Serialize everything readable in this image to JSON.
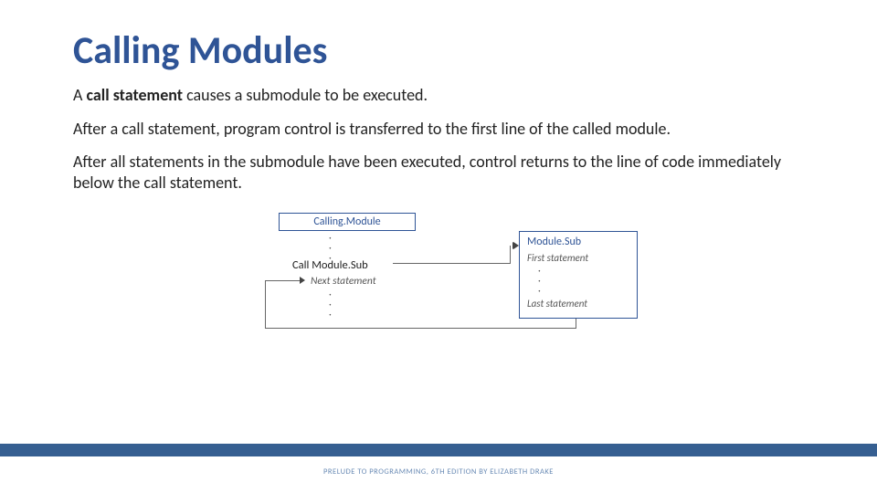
{
  "title": "Calling Modules",
  "para1_pre": "A ",
  "para1_bold": "call statement",
  "para1_post": " causes a submodule to be executed.",
  "para2": "After a call statement, program control is transferred to the first line of the called module.",
  "para3": "After all statements in the submodule have been executed, control returns to the line of code immediately below the call statement.",
  "diagram": {
    "calling_label": "Calling.Module",
    "call_text": "Call Module.Sub",
    "next_text": "Next statement",
    "sub_label": "Module.Sub",
    "first_stmt": "First statement",
    "last_stmt": "Last statement",
    "dots": ". . ."
  },
  "footer": "PRELUDE TO PROGRAMMING, 6TH EDITION BY ELIZABETH DRAKE"
}
